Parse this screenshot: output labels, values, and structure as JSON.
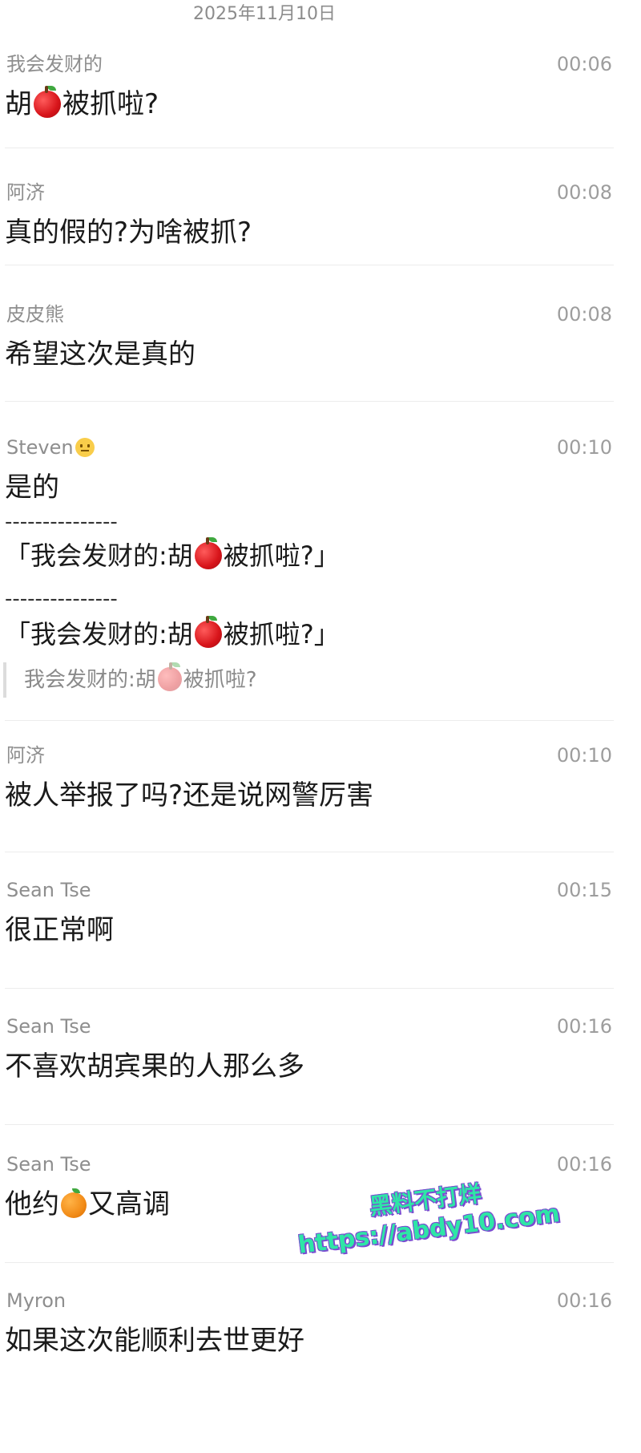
{
  "header": {
    "date": "2025年11月10日"
  },
  "messages": [
    {
      "sender": "我会发财的",
      "time": "00:06",
      "text_a": "胡",
      "emoji": "apple",
      "text_b": "被抓啦?"
    },
    {
      "sender": "阿济",
      "time": "00:08",
      "text": "真的假的?为啥被抓?"
    },
    {
      "sender": "皮皮熊",
      "time": "00:08",
      "text": "希望这次是真的"
    },
    {
      "sender": "Steven",
      "sender_emoji": "smiley",
      "time": "00:10",
      "text": "是的",
      "dashes": "---------------",
      "quote_a": "「我会发财的:胡",
      "quote_b": "被抓啦?」",
      "reply_a": "我会发财的:胡",
      "reply_b": "被抓啦?"
    },
    {
      "sender": "阿济",
      "time": "00:10",
      "text": "被人举报了吗?还是说网警厉害"
    },
    {
      "sender": "Sean Tse",
      "time": "00:15",
      "text": "很正常啊"
    },
    {
      "sender": "Sean Tse",
      "time": "00:16",
      "text": "不喜欢胡宾果的人那么多"
    },
    {
      "sender": "Sean Tse",
      "time": "00:16",
      "text_a": "他约",
      "emoji": "orange",
      "text_b": "又高调"
    },
    {
      "sender": "Myron",
      "time": "00:16",
      "text": "如果这次能顺利去世更好"
    }
  ],
  "watermark": {
    "line1": "黑料不打烊",
    "line2": "https://abdy10.com"
  },
  "colors": {
    "watermark_fill": "#2ee6a6",
    "watermark_stroke": "#7a4bd1",
    "divider": "#ececec"
  }
}
